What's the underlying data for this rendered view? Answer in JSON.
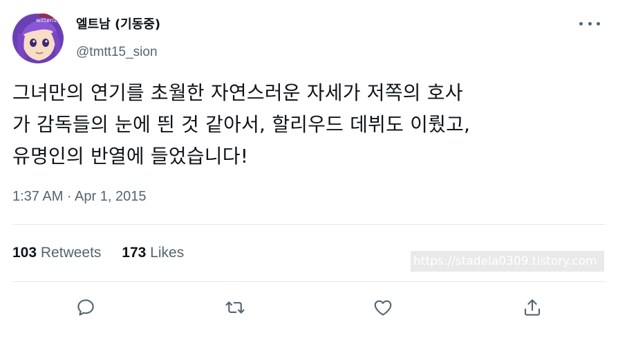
{
  "author": {
    "display_name": "엘트남 (기동중)",
    "handle": "@tmtt15_sion",
    "avatar_text": "witter/z"
  },
  "tweet": {
    "lines": [
      "그녀만의 연기를 초월한 자연스러운 자세가 저쪽의 호사",
      "가 감독들의 눈에 띈 것 같아서, 할리우드 데뷔도 이뤘고,",
      "유명인의 반열에 들었습니다!"
    ],
    "timestamp": "1:37 AM · Apr 1, 2015"
  },
  "stats": {
    "retweets_count": "103",
    "retweets_label": "Retweets",
    "likes_count": "173",
    "likes_label": "Likes"
  },
  "watermark": "https://stadela0309.tistory.com",
  "actions": {
    "icons": [
      "reply-icon",
      "retweet-icon",
      "like-icon",
      "share-icon"
    ]
  },
  "colors": {
    "text": "#0f1419",
    "secondary": "#536471",
    "divider": "#e6e9eb"
  }
}
